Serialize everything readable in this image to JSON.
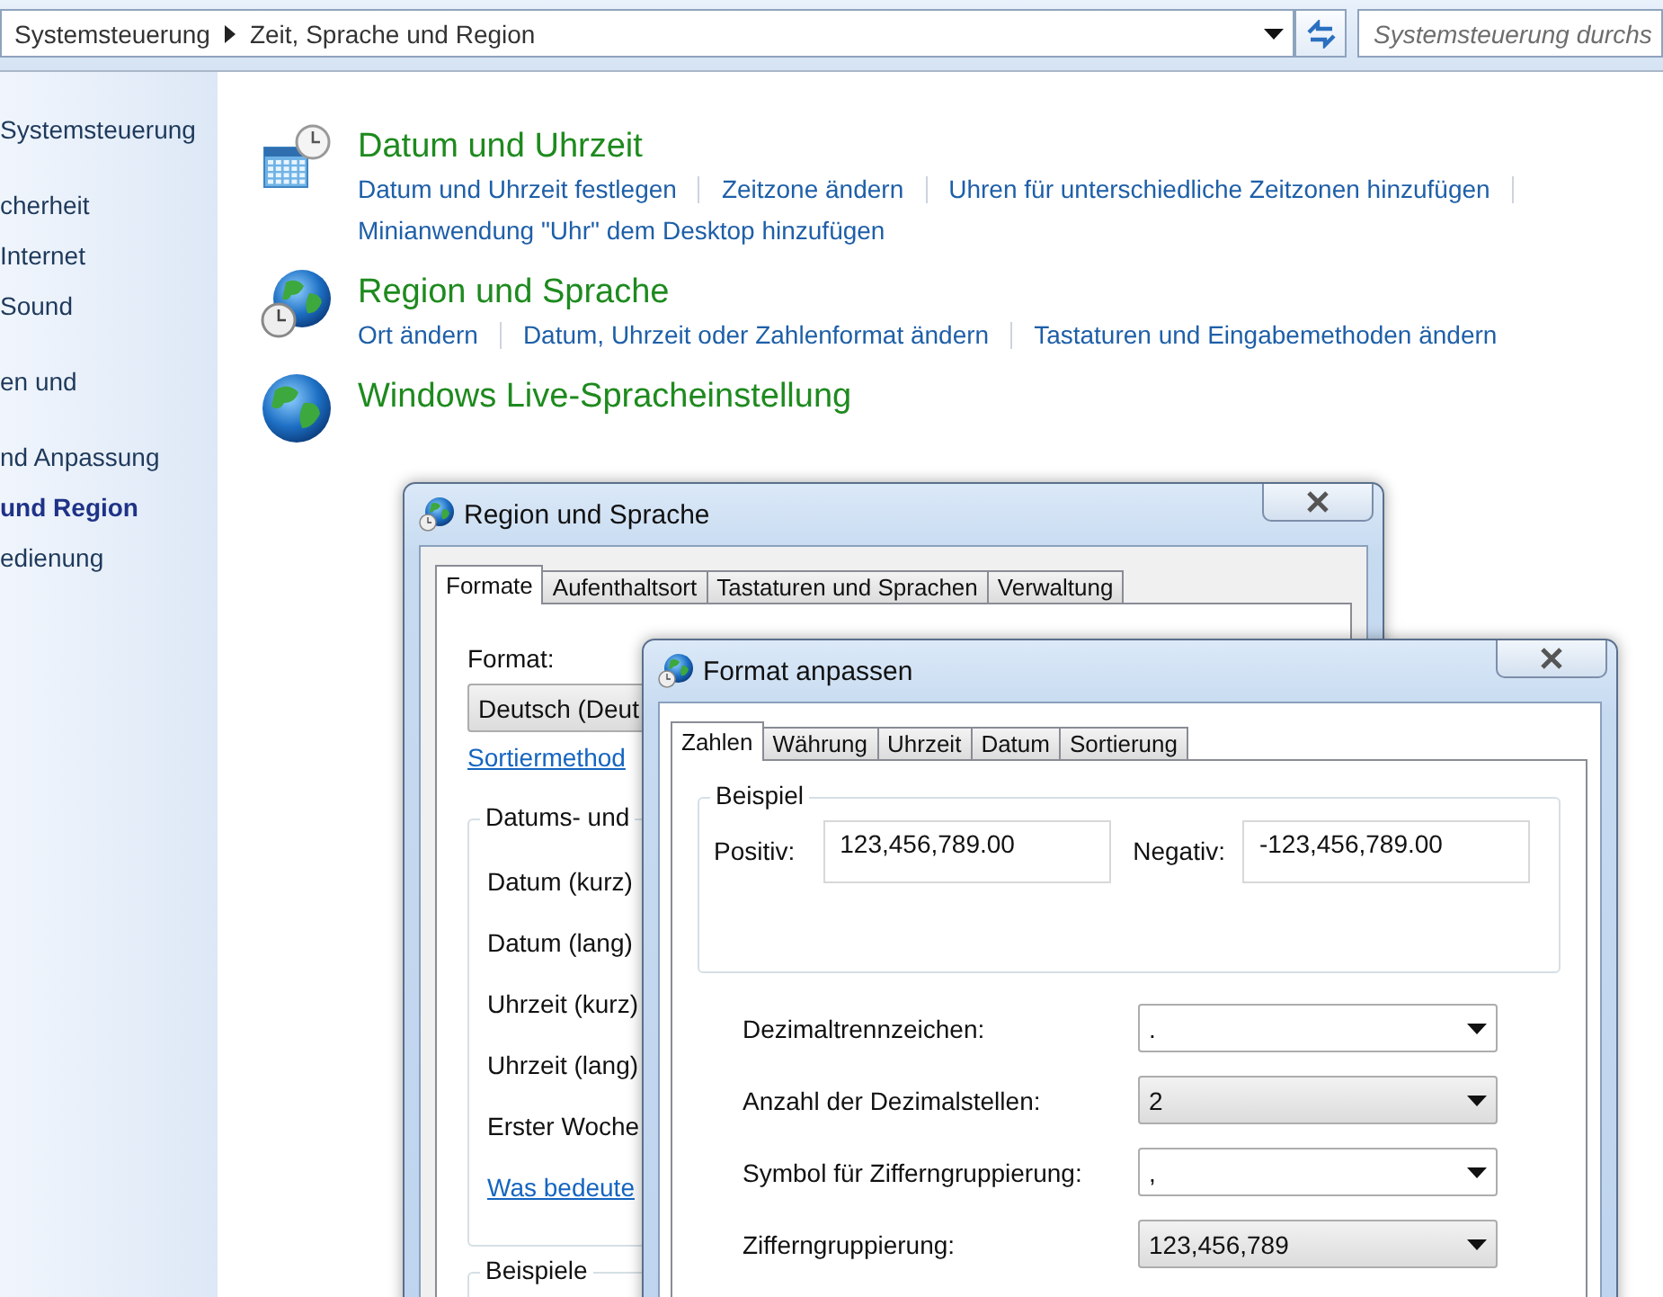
{
  "address_bar": {
    "breadcrumb": [
      "Systemsteuerung",
      "Zeit, Sprache und Region"
    ],
    "search": {
      "placeholder": "Systemsteuerung durchs"
    }
  },
  "sidebar": {
    "sections": [
      {
        "items": [
          {
            "label": "Systemsteuerung",
            "selected": false
          }
        ]
      },
      {
        "items": [
          {
            "label": "cherheit",
            "selected": false
          },
          {
            "label": "Internet",
            "selected": false
          },
          {
            "label": "Sound",
            "selected": false
          }
        ]
      },
      {
        "items": [
          {
            "label": "en und",
            "selected": false
          }
        ]
      },
      {
        "items": [
          {
            "label": "nd Anpassung",
            "selected": false
          },
          {
            "label": "und Region",
            "selected": true
          },
          {
            "label": "edienung",
            "selected": false
          }
        ]
      }
    ]
  },
  "categories": [
    {
      "kind": "calendar",
      "title": "Datum und Uhrzeit",
      "links": [
        "Datum und Uhrzeit festlegen",
        "Zeitzone ändern",
        "Uhren für unterschiedliche Zeitzonen hinzufügen",
        "Minianwendung \"Uhr\" dem Desktop hinzufügen"
      ]
    },
    {
      "kind": "globe-clock",
      "title": "Region und Sprache",
      "links": [
        "Ort ändern",
        "Datum, Uhrzeit oder Zahlenformat ändern",
        "Tastaturen und Eingabemethoden ändern"
      ]
    },
    {
      "kind": "globe",
      "title": "Windows Live-Spracheinstellung"
    }
  ],
  "region_dialog": {
    "title": "Region und Sprache",
    "tabs": [
      {
        "label": "Formate",
        "selected": true
      },
      {
        "label": "Aufenthaltsort",
        "selected": false
      },
      {
        "label": "Tastaturen und Sprachen",
        "selected": false
      },
      {
        "label": "Verwaltung",
        "selected": false
      }
    ],
    "format_label": "Format:",
    "format_value": "Deutsch (Deut",
    "sort_link": "Sortiermethod",
    "group": {
      "title": "Datums- und",
      "rows": [
        "Datum (kurz)",
        "Datum (lang)",
        "Uhrzeit (kurz)",
        "Uhrzeit (lang)",
        "Erster Woche"
      ]
    },
    "help_link": "Was bedeute",
    "examples_group": {
      "title": "Beispiele"
    }
  },
  "format_dialog": {
    "title": "Format anpassen",
    "tabs": [
      {
        "label": "Zahlen",
        "selected": true
      },
      {
        "label": "Währung",
        "selected": false
      },
      {
        "label": "Uhrzeit",
        "selected": false
      },
      {
        "label": "Datum",
        "selected": false
      },
      {
        "label": "Sortierung",
        "selected": false
      }
    ],
    "example": {
      "title": "Beispiel",
      "positive_label": "Positiv:",
      "positive_value": "123,456,789.00",
      "negative_label": "Negativ:",
      "negative_value": "-123,456,789.00"
    },
    "settings": [
      {
        "label": "Dezimaltrennzeichen:",
        "value": ".",
        "kind": "editable"
      },
      {
        "label": "Anzahl der Dezimalstellen:",
        "value": "2",
        "kind": "list"
      },
      {
        "label": "Symbol für Zifferngruppierung:",
        "value": ",",
        "kind": "editable"
      },
      {
        "label": "Zifferngruppierung:",
        "value": "123,456,789",
        "kind": "list"
      }
    ]
  }
}
